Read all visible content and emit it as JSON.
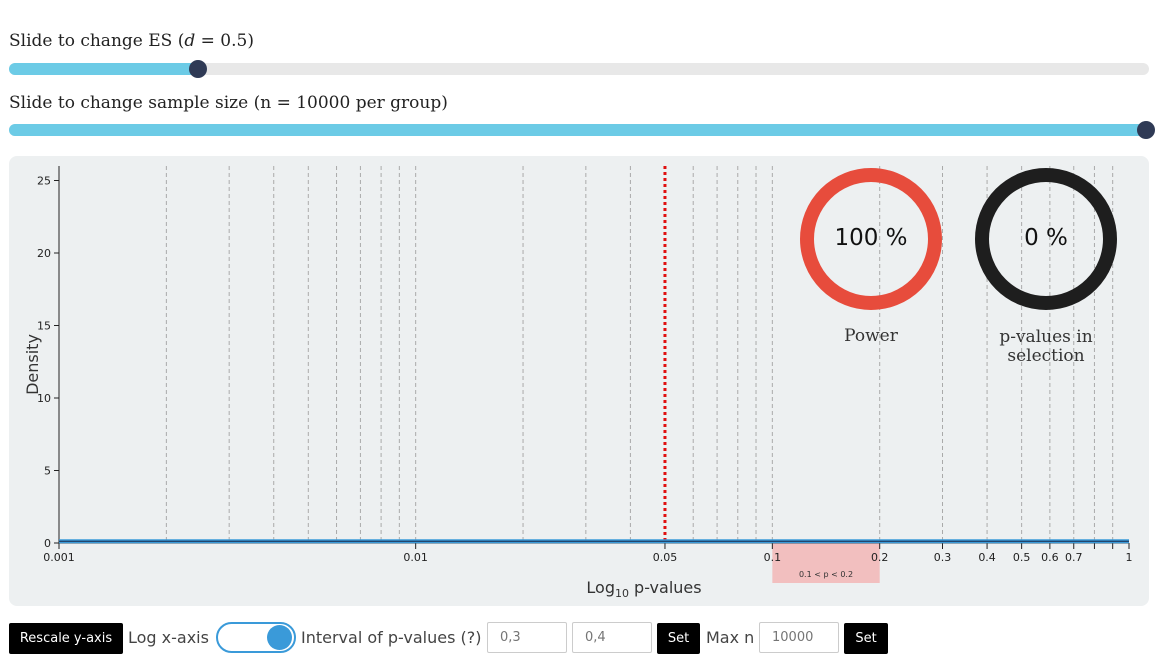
{
  "es_slider": {
    "label_prefix": "Slide to change ES (",
    "label_var": "d",
    "label_suffix": " = 0.5)",
    "value_fraction": 0.166
  },
  "n_slider": {
    "label": "Slide to change sample size (n = 10000 per group)",
    "value_fraction": 1.0
  },
  "power_ring": {
    "value": "100 %",
    "label": "Power",
    "color": "#e74c3c"
  },
  "selection_ring": {
    "value": "0 %",
    "label_line1": "p-values in",
    "label_line2": "selection",
    "color": "#1e1e1e"
  },
  "colors": {
    "accent": "#6ccbe6",
    "knob": "#2f3a55",
    "alpha_line": "#e01010",
    "selection_band": "#f2bfbf",
    "curve": "#3a9ad9"
  },
  "controls": {
    "rescale_label": "Rescale y-axis",
    "log_label": "Log x-axis",
    "log_enabled": true,
    "interval_label": "Interval of p-values (?)",
    "interval_low_placeholder": "0,3",
    "interval_high_placeholder": "0,4",
    "set_label": "Set",
    "maxn_label": "Max n",
    "maxn_placeholder": "10000",
    "set2_label": "Set"
  },
  "chart_data": {
    "type": "line",
    "title": "",
    "xlabel_base": "Log",
    "xlabel_sub": "10",
    "xlabel_rest": " p-values",
    "ylabel": "Density",
    "x_scale": "log",
    "xlim": [
      0.001,
      1
    ],
    "ylim": [
      0,
      26
    ],
    "x_ticks": [
      {
        "v": 0.001,
        "label": "0.001"
      },
      {
        "v": 0.01,
        "label": "0.01"
      },
      {
        "v": 0.05,
        "label": "0.05"
      },
      {
        "v": 0.1,
        "label": "0.1"
      },
      {
        "v": 0.2,
        "label": "0.2"
      },
      {
        "v": 0.3,
        "label": "0.3"
      },
      {
        "v": 0.4,
        "label": "0.4"
      },
      {
        "v": 0.5,
        "label": "0.5"
      },
      {
        "v": 0.6,
        "label": "0.6"
      },
      {
        "v": 0.7,
        "label": "0.7"
      },
      {
        "v": 0.8,
        "label": ""
      },
      {
        "v": 0.9,
        "label": ""
      },
      {
        "v": 1,
        "label": "1"
      }
    ],
    "y_ticks": [
      0,
      5,
      10,
      15,
      20,
      25
    ],
    "gridlines": [
      0.002,
      0.003,
      0.004,
      0.005,
      0.006,
      0.007,
      0.008,
      0.009,
      0.01,
      0.02,
      0.03,
      0.04,
      0.06,
      0.07,
      0.08,
      0.09,
      0.1,
      0.2,
      0.3,
      0.4,
      0.5,
      0.6,
      0.7,
      0.8,
      0.9
    ],
    "alpha": 0.05,
    "selection": {
      "low": 0.1,
      "high": 0.2,
      "label": "0.1 < p < 0.2"
    },
    "series": [
      {
        "x": [
          0.001,
          0.01,
          0.05,
          0.1,
          0.2,
          0.5,
          1
        ],
        "y": [
          0.05,
          0.05,
          0.05,
          0.05,
          0.05,
          0.05,
          0.05
        ]
      }
    ]
  }
}
